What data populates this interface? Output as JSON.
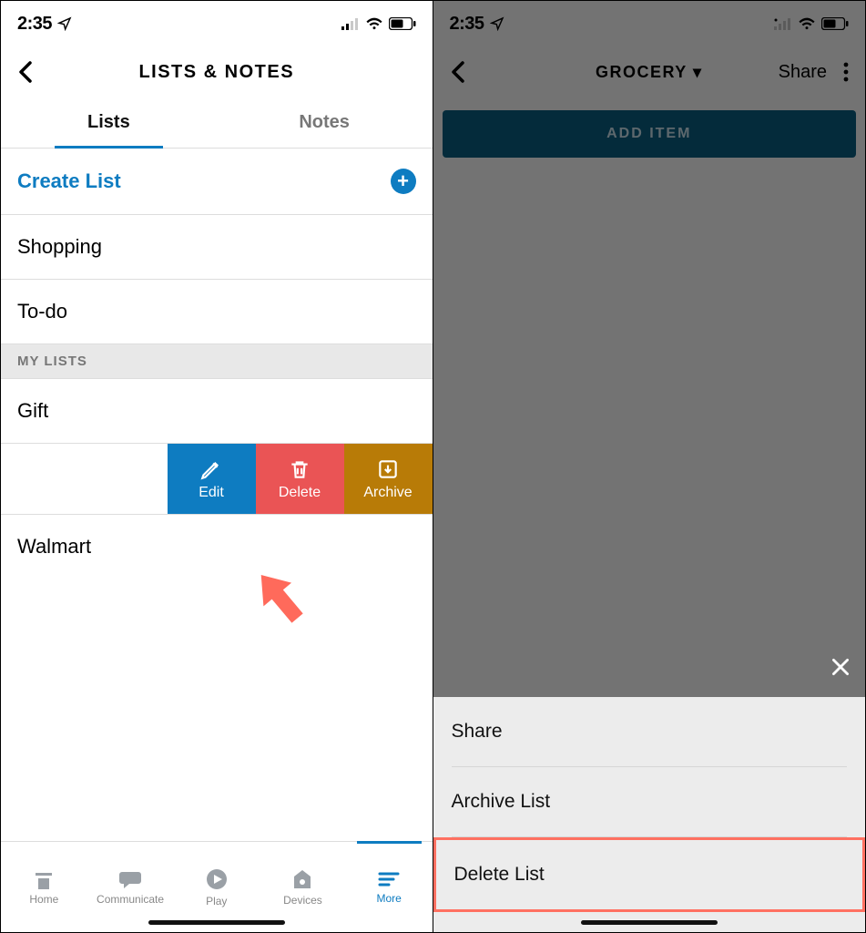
{
  "left": {
    "status": {
      "time": "2:35"
    },
    "header": {
      "title": "LISTS & NOTES"
    },
    "tabs": {
      "lists": "Lists",
      "notes": "Notes"
    },
    "create_label": "Create List",
    "lists": {
      "shopping": "Shopping",
      "todo": "To-do"
    },
    "section_header": "MY LISTS",
    "mylists": {
      "gift": "Gift",
      "walmart": "Walmart"
    },
    "swipe": {
      "edit": "Edit",
      "delete": "Delete",
      "archive": "Archive"
    },
    "nav": {
      "home": "Home",
      "communicate": "Communicate",
      "play": "Play",
      "devices": "Devices",
      "more": "More"
    }
  },
  "right": {
    "status": {
      "time": "2:35"
    },
    "header": {
      "title": "GROCERY ▾",
      "share": "Share"
    },
    "add_item": "ADD ITEM",
    "sheet": {
      "share": "Share",
      "archive": "Archive List",
      "delete": "Delete List"
    }
  }
}
